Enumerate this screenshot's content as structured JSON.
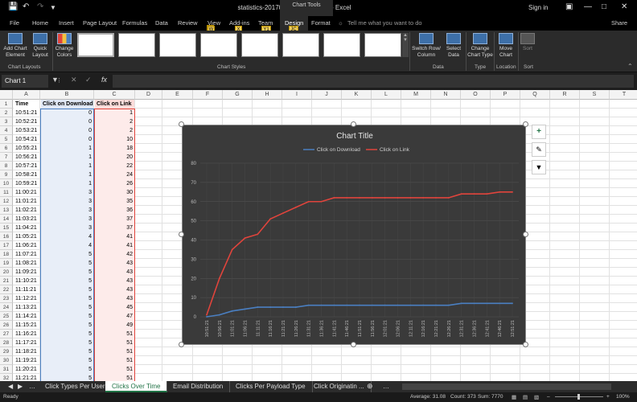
{
  "window": {
    "title": "statistics-20170120-155835.xlsx - Excel",
    "chart_tools": "Chart Tools",
    "signin": "Sign in",
    "share": "Share"
  },
  "ribbon": {
    "tabs": [
      "File",
      "Home",
      "Insert",
      "Page Layout",
      "Formulas",
      "Data",
      "Review",
      "View",
      "Add-ins",
      "Team",
      "Design",
      "Format"
    ],
    "active_tab": "Design",
    "tell_me": "Tell me what you want to do",
    "keytips": [
      "R",
      "W",
      "X",
      "Y1",
      "JC"
    ],
    "buttons": {
      "add_chart_element": "Add Chart Element",
      "quick_layout": "Quick Layout",
      "change_colors": "Change Colors",
      "switch_row_column": "Switch Row/ Column",
      "select_data": "Select Data",
      "change_chart_type": "Change Chart Type",
      "move_chart": "Move Chart",
      "sort": "Sort"
    },
    "groups": {
      "chart_layouts": "Chart Layouts",
      "chart_styles": "Chart Styles",
      "data": "Data",
      "type": "Type",
      "location": "Location",
      "sort": "Sort"
    }
  },
  "formula_bar": {
    "name_box": "Chart 1",
    "fx": "fx"
  },
  "sheet": {
    "columns": [
      "A",
      "B",
      "C",
      "D",
      "E",
      "F",
      "G",
      "H",
      "I",
      "J",
      "K",
      "L",
      "M",
      "N",
      "O",
      "P",
      "Q",
      "R",
      "S",
      "T"
    ],
    "headers": [
      "Time",
      "Click on Download",
      "Click on Link"
    ],
    "rows": [
      [
        "10:51:21",
        "0",
        "1"
      ],
      [
        "10:52:21",
        "0",
        "2"
      ],
      [
        "10:53:21",
        "0",
        "2"
      ],
      [
        "10:54:21",
        "0",
        "10"
      ],
      [
        "10:55:21",
        "1",
        "18"
      ],
      [
        "10:56:21",
        "1",
        "20"
      ],
      [
        "10:57:21",
        "1",
        "22"
      ],
      [
        "10:58:21",
        "1",
        "24"
      ],
      [
        "10:59:21",
        "1",
        "26"
      ],
      [
        "11:00:21",
        "3",
        "30"
      ],
      [
        "11:01:21",
        "3",
        "35"
      ],
      [
        "11:02:21",
        "3",
        "36"
      ],
      [
        "11:03:21",
        "3",
        "37"
      ],
      [
        "11:04:21",
        "3",
        "37"
      ],
      [
        "11:05:21",
        "4",
        "41"
      ],
      [
        "11:06:21",
        "4",
        "41"
      ],
      [
        "11:07:21",
        "5",
        "42"
      ],
      [
        "11:08:21",
        "5",
        "43"
      ],
      [
        "11:09:21",
        "5",
        "43"
      ],
      [
        "11:10:21",
        "5",
        "43"
      ],
      [
        "11:11:21",
        "5",
        "43"
      ],
      [
        "11:12:21",
        "5",
        "43"
      ],
      [
        "11:13:21",
        "5",
        "45"
      ],
      [
        "11:14:21",
        "5",
        "47"
      ],
      [
        "11:15:21",
        "5",
        "49"
      ],
      [
        "11:16:21",
        "5",
        "51"
      ],
      [
        "11:17:21",
        "5",
        "51"
      ],
      [
        "11:18:21",
        "5",
        "51"
      ],
      [
        "11:19:21",
        "5",
        "51"
      ],
      [
        "11:20:21",
        "5",
        "51"
      ],
      [
        "11:21:21",
        "5",
        "51"
      ]
    ]
  },
  "sheet_tabs": [
    "Click Types Per User",
    "Clicks Over Time",
    "Email Distribution",
    "Clicks Per Payload Type",
    "Click Originatin ..."
  ],
  "active_sheet": "Clicks Over Time",
  "status": {
    "ready": "Ready",
    "average": "Average: 31.08",
    "count": "Count: 373",
    "sum": "Sum: 7770",
    "zoom": "100%"
  },
  "colors": {
    "download": "#4a7fc1",
    "link": "#e0443c",
    "chart_bg": "#3a3a3a",
    "excel_green": "#217346"
  },
  "chart_data": {
    "type": "line",
    "title": "Chart Title",
    "ylim": [
      0,
      80
    ],
    "yticks": [
      0,
      10,
      20,
      30,
      40,
      50,
      60,
      70,
      80
    ],
    "legend_position": "top",
    "grid": true,
    "x": [
      "10:51:21",
      "10:56:21",
      "11:01:21",
      "11:06:21",
      "11:11:21",
      "11:16:21",
      "11:21:21",
      "11:26:21",
      "11:31:21",
      "11:36:21",
      "11:41:21",
      "11:46:21",
      "11:51:21",
      "11:56:21",
      "12:01:21",
      "12:06:21",
      "12:11:21",
      "12:16:21",
      "12:21:21",
      "12:26:21",
      "12:31:21",
      "12:36:21",
      "12:41:21",
      "12:46:21",
      "12:51:21"
    ],
    "series": [
      {
        "name": "Click on Download",
        "values": [
          0,
          1,
          3,
          4,
          5,
          5,
          5,
          5,
          6,
          6,
          6,
          6,
          6,
          6,
          6,
          6,
          6,
          6,
          6,
          6,
          7,
          7,
          7,
          7,
          7
        ]
      },
      {
        "name": "Click on Link",
        "values": [
          1,
          20,
          35,
          41,
          43,
          51,
          54,
          57,
          60,
          60,
          62,
          62,
          62,
          62,
          62,
          62,
          62,
          62,
          62,
          62,
          64,
          64,
          64,
          65,
          65
        ]
      }
    ]
  }
}
